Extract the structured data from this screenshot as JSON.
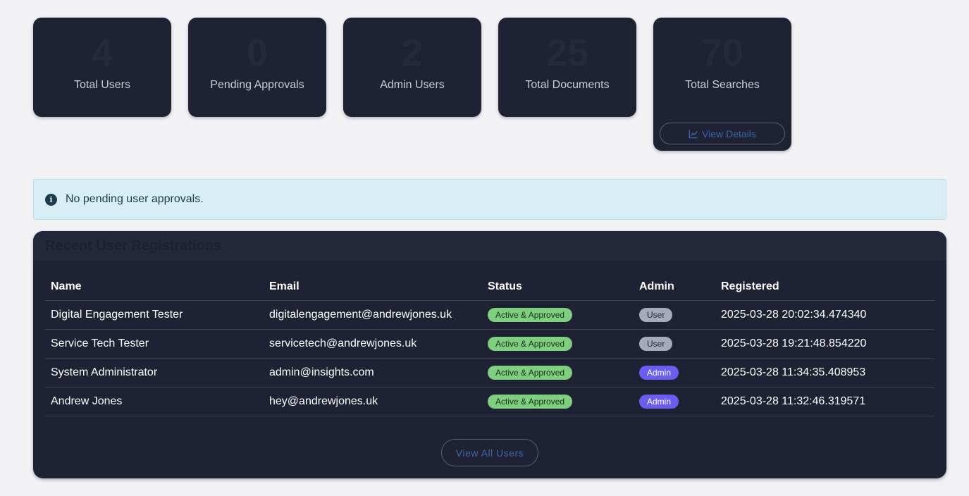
{
  "stats": [
    {
      "value": "4",
      "label": "Total Users"
    },
    {
      "value": "0",
      "label": "Pending Approvals"
    },
    {
      "value": "2",
      "label": "Admin Users"
    },
    {
      "value": "25",
      "label": "Total Documents"
    },
    {
      "value": "70",
      "label": "Total Searches",
      "action_label": "View Details",
      "action_icon": "chart-line-icon"
    }
  ],
  "alert": {
    "icon": "info-icon",
    "text": "No pending user approvals."
  },
  "registrations": {
    "title": "Recent User Registrations",
    "columns": [
      "Name",
      "Email",
      "Status",
      "Admin",
      "Registered"
    ],
    "rows": [
      {
        "name": "Digital Engagement Tester",
        "email": "digitalengagement@andrewjones.uk",
        "status": "Active & Approved",
        "role": "User",
        "registered": "2025-03-28 20:02:34.474340"
      },
      {
        "name": "Service Tech Tester",
        "email": "servicetech@andrewjones.uk",
        "status": "Active & Approved",
        "role": "User",
        "registered": "2025-03-28 19:21:48.854220"
      },
      {
        "name": "System Administrator",
        "email": "admin@insights.com",
        "status": "Active & Approved",
        "role": "Admin",
        "registered": "2025-03-28 11:34:35.408953"
      },
      {
        "name": "Andrew Jones",
        "email": "hey@andrewjones.uk",
        "status": "Active & Approved",
        "role": "Admin",
        "registered": "2025-03-28 11:32:46.319571"
      }
    ],
    "view_all_label": "View All Users"
  },
  "colors": {
    "card_bg": "#1e2233",
    "status_badge": "#7ed07f",
    "user_badge": "#a6abbc",
    "admin_badge": "#6e5cf0",
    "alert_bg": "#d6eef4"
  }
}
